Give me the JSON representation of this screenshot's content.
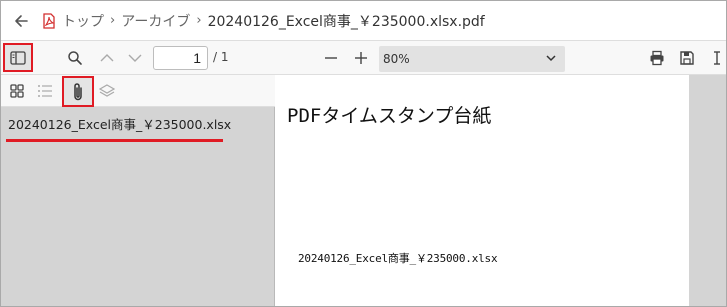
{
  "breadcrumb": {
    "items": [
      "トップ",
      "アーカイブ",
      "20240126_Excel商事_￥235000.xlsx.pdf"
    ]
  },
  "toolbar": {
    "page_current": "1",
    "page_total": "/ 1",
    "zoom": "80%"
  },
  "sidebar": {
    "attachments": [
      "20240126_Excel商事_￥235000.xlsx"
    ]
  },
  "document": {
    "title": "PDFタイムスタンプ台紙",
    "filename": "20240126_Excel商事_￥235000.xlsx"
  },
  "colors": {
    "highlight": "#e01b24",
    "pdf_icon": "#d32f2f",
    "sidebar_bg": "#d4d4d4",
    "toolbar_bg": "#f8f8f8"
  },
  "icons": [
    "back-arrow-icon",
    "pdf-file-icon",
    "chevron-right-icon",
    "sidebar-toggle-icon",
    "search-icon",
    "chevron-up-icon",
    "chevron-down-icon",
    "minus-icon",
    "plus-icon",
    "printer-icon",
    "save-icon",
    "text-cursor-icon",
    "thumbnails-icon",
    "outline-icon",
    "paperclip-icon",
    "layers-icon"
  ]
}
